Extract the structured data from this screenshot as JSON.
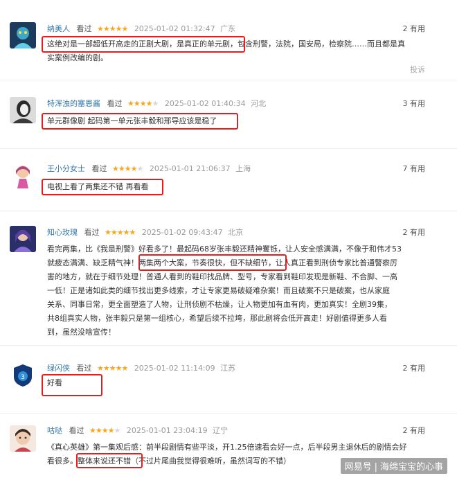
{
  "reviews": [
    {
      "user": "纳美人",
      "watched": "看过",
      "stars": 5,
      "time": "2025-01-02 01:32:47",
      "location": "广东",
      "useful": "2 有用",
      "lines": [
        "这绝对是一部超低开高走的正剧大剧，是真正的单元剧，包含刑警，法院，国安局，检察院……而且都是真",
        "实案例改编的剧。"
      ],
      "report": "投诉"
    },
    {
      "user": "特浑浊的塞恩酱",
      "watched": "看过",
      "stars": 4,
      "time": "2025-01-02 01:40:34",
      "location": "河北",
      "useful": "3 有用",
      "lines": [
        "单元群像剧 起码第一单元张丰毅和邢导应该是稳了"
      ]
    },
    {
      "user": "王小分女士",
      "watched": "看过",
      "stars": 4,
      "time": "2025-01-01 21:06:37",
      "location": "上海",
      "useful": "7 有用",
      "lines": [
        "电视上看了两集还不错 再看看"
      ]
    },
    {
      "user": "知心玫瑰",
      "watched": "看过",
      "stars": 5,
      "time": "2025-01-02 09:43:47",
      "location": "北京",
      "useful": "2 有用",
      "lines": [
        "看完两集，比《我是刑警》好看多了！最起码68岁张丰毅还精神矍铄，让人安全感满满，不像于和伟才53",
        "就疲态满满、缺乏精气神！两集两个大案，节奏很快，但不缺细节，让人真正看到刑侦专家比普通警察厉",
        "害的地方，就在于细节处理！普通人看到的鞋印找品牌、型号，专家看到鞋印发现是新鞋、不合脚、一高",
        "一低！正是诸如此类的细节找出更多线索，才让专家更易破疑难杂案！而且破案不只是破案，也从家庭",
        "关系、同事日常，更全面塑造了人物，让刑侦剧不枯燥，让人物更加有血有肉，更加真实！全剧39集，",
        "共8组真实人物，张丰毅只是第一组核心，希望后续不拉垮，那此剧将会低开高走！好剧值得更多人看",
        "到，虽然没啥宣传！"
      ]
    },
    {
      "user": "绿闪侠",
      "watched": "看过",
      "stars": 5,
      "time": "2025-01-02 11:14:09",
      "location": "江苏",
      "useful": "2 有用",
      "lines": [
        "好看"
      ]
    },
    {
      "user": "咕哒",
      "watched": "看过",
      "stars": 4,
      "time": "2025-01-01 23:04:19",
      "location": "辽宁",
      "useful": "2 有用",
      "lines": [
        "《真心英雄》第一集观后感：前半段剧情有些平淡，开1.25倍速看会好一点，后半段男主退休后的剧情会好",
        "看很多。整体来说还不错（不过片尾曲我觉得很难听，虽然词写的不错）"
      ]
    }
  ],
  "watermark": {
    "brand": "网易号",
    "author": "海绵宝宝的心事"
  },
  "colors": {
    "highlight": "#e02020",
    "username": "#3377aa",
    "star": "#f5a623"
  }
}
